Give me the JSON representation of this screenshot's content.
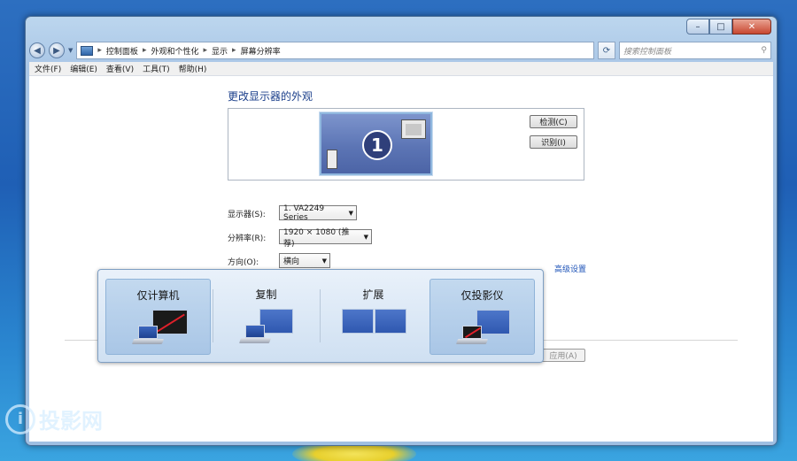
{
  "window": {
    "caption_buttons": {
      "minimize": "–",
      "maximize": "□",
      "close": "✕"
    },
    "breadcrumb": [
      "控制面板",
      "外观和个性化",
      "显示",
      "屏幕分辨率"
    ],
    "search_placeholder": "搜索控制面板",
    "menu": [
      "文件(F)",
      "编辑(E)",
      "查看(V)",
      "工具(T)",
      "帮助(H)"
    ]
  },
  "display": {
    "heading": "更改显示器的外观",
    "monitor_number": "1",
    "detect_label": "检测(C)",
    "identify_label": "识别(I)",
    "monitor_label": "显示器(S):",
    "monitor_value": "1. VA2249 Series",
    "resolution_label": "分辨率(R):",
    "resolution_value": "1920 × 1080 (推荐)",
    "orientation_label": "方向(O):",
    "orientation_value": "横向",
    "advanced_link": "高级设置",
    "apply_label": "应用(A)"
  },
  "projection": {
    "options": [
      {
        "label": "仅计算机",
        "selected": true
      },
      {
        "label": "复制",
        "selected": false
      },
      {
        "label": "扩展",
        "selected": false
      },
      {
        "label": "仅投影仪",
        "selected": true
      }
    ]
  },
  "watermark": {
    "text": "投影网"
  }
}
